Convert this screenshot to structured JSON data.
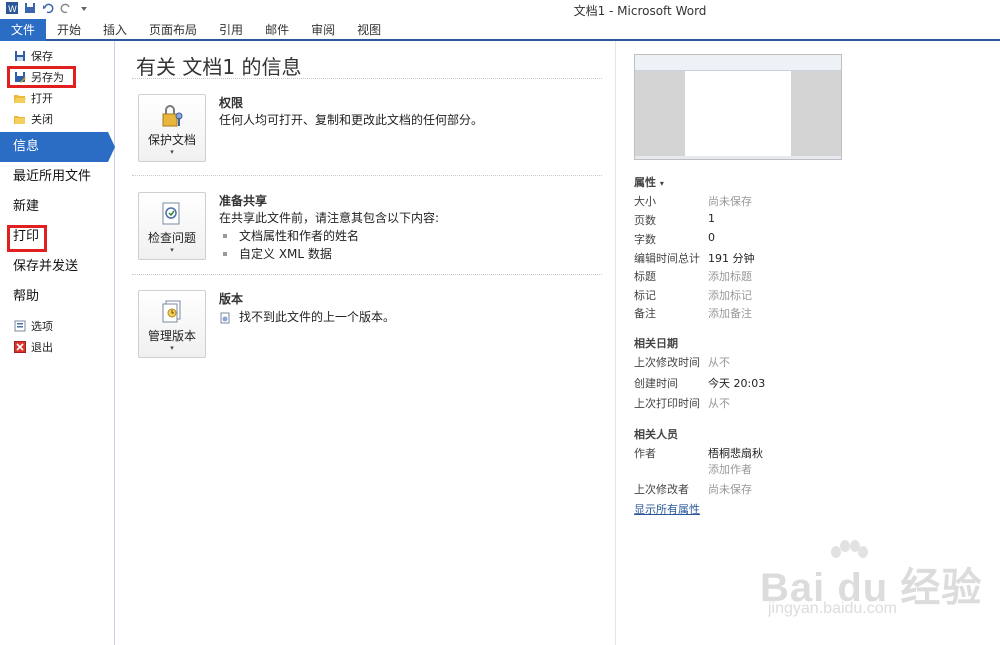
{
  "window": {
    "title": "文档1 - Microsoft Word"
  },
  "ribbon": {
    "file_tab": "文件",
    "tabs": [
      "开始",
      "插入",
      "页面布局",
      "引用",
      "邮件",
      "审阅",
      "视图"
    ]
  },
  "nav": {
    "small_top": [
      {
        "label": "保存",
        "icon": "save-icon"
      },
      {
        "label": "另存为",
        "icon": "save-as-icon"
      },
      {
        "label": "打开",
        "icon": "open-folder-icon"
      },
      {
        "label": "关闭",
        "icon": "close-folder-icon"
      }
    ],
    "big": [
      "信息",
      "最近所用文件",
      "新建",
      "打印",
      "保存并发送",
      "帮助"
    ],
    "small_bottom": [
      {
        "label": "选项",
        "icon": "options-icon"
      },
      {
        "label": "退出",
        "icon": "exit-icon"
      }
    ]
  },
  "main": {
    "title": "有关 文档1 的信息",
    "sections": [
      {
        "button": "保护文档",
        "heading": "权限",
        "desc": "任何人均可打开、复制和更改此文档的任何部分。"
      },
      {
        "button": "检查问题",
        "heading": "准备共享",
        "desc": "在共享此文件前，请注意其包含以下内容:",
        "bullets": [
          "文档属性和作者的姓名",
          "自定义 XML 数据"
        ]
      },
      {
        "button": "管理版本",
        "heading": "版本",
        "desc": "找不到此文件的上一个版本。"
      }
    ]
  },
  "properties": {
    "heading": "属性",
    "rows": [
      {
        "k": "大小",
        "v": "尚未保存",
        "muted": true
      },
      {
        "k": "页数",
        "v": "1",
        "muted": false
      },
      {
        "k": "字数",
        "v": "0",
        "muted": false
      },
      {
        "k": "编辑时间总计",
        "v": "191 分钟",
        "muted": false
      },
      {
        "k": "标题",
        "v": "添加标题",
        "muted": true
      },
      {
        "k": "标记",
        "v": "添加标记",
        "muted": true
      },
      {
        "k": "备注",
        "v": "添加备注",
        "muted": true
      }
    ],
    "dates_heading": "相关日期",
    "dates": [
      {
        "k": "上次修改时间",
        "v": "从不",
        "muted": true
      },
      {
        "k": "创建时间",
        "v": "今天 20:03",
        "muted": false
      },
      {
        "k": "上次打印时间",
        "v": "从不",
        "muted": true
      }
    ],
    "people_heading": "相关人员",
    "people": [
      {
        "k": "作者",
        "v": "梧桐悲扇秋",
        "muted": false
      },
      {
        "k": "",
        "v": "添加作者",
        "muted": true
      },
      {
        "k": "上次修改者",
        "v": "尚未保存",
        "muted": true
      }
    ],
    "show_all": "显示所有属性"
  },
  "watermark": {
    "line1": "Bai du 经验",
    "line2": "jingyan.baidu.com"
  },
  "colors": {
    "accent": "#2b6cc4",
    "highlight_box": "#e02020"
  }
}
